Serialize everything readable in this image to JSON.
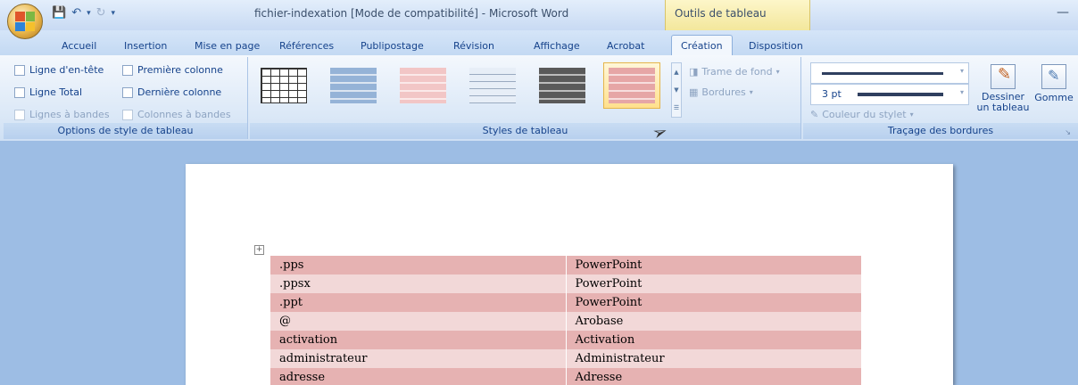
{
  "window": {
    "title": "fichier-indexation [Mode de compatibilité] - Microsoft Word",
    "context_label": "Outils de tableau"
  },
  "tabs": [
    {
      "label": "Accueil"
    },
    {
      "label": "Insertion"
    },
    {
      "label": "Mise en page"
    },
    {
      "label": "Références"
    },
    {
      "label": "Publipostage"
    },
    {
      "label": "Révision"
    },
    {
      "label": "Affichage"
    },
    {
      "label": "Acrobat"
    },
    {
      "label": "Création",
      "active": true
    },
    {
      "label": "Disposition"
    }
  ],
  "style_options": {
    "label": "Options de style de tableau",
    "header_row": "Ligne d'en-tête",
    "total_row": "Ligne Total",
    "banded_rows": "Lignes à bandes",
    "first_column": "Première colonne",
    "last_column": "Dernière colonne",
    "banded_columns": "Colonnes à bandes"
  },
  "table_styles": {
    "label": "Styles de tableau",
    "shading": "Trame de fond",
    "borders": "Bordures"
  },
  "draw_borders": {
    "label": "Traçage des bordures",
    "pen_weight": "3 pt",
    "pen_color": "Couleur du stylet",
    "draw_table": "Dessiner un tableau",
    "eraser": "Gomme"
  },
  "document": {
    "rows": [
      [
        ".pps",
        "PowerPoint"
      ],
      [
        ".ppsx",
        "PowerPoint"
      ],
      [
        ".ppt",
        "PowerPoint"
      ],
      [
        "@",
        "Arobase"
      ],
      [
        "activation",
        "Activation"
      ],
      [
        "administrateur",
        "Administrateur"
      ],
      [
        "adresse",
        "Adresse"
      ]
    ]
  }
}
